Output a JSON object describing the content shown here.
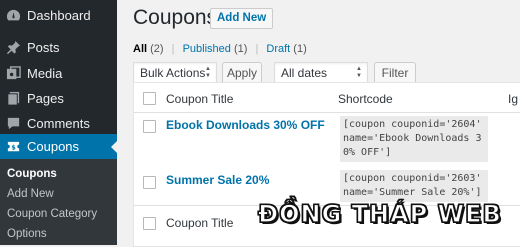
{
  "sidebar": {
    "items": [
      {
        "label": "Dashboard",
        "icon": "dashboard-icon"
      },
      {
        "label": "Posts",
        "icon": "pin-icon"
      },
      {
        "label": "Media",
        "icon": "media-icon"
      },
      {
        "label": "Pages",
        "icon": "pages-icon"
      },
      {
        "label": "Comments",
        "icon": "comments-icon"
      },
      {
        "label": "Coupons",
        "icon": "coupon-icon",
        "current": true
      }
    ],
    "submenu": [
      "Coupons",
      "Add New",
      "Coupon Category",
      "Options"
    ],
    "colors": {
      "bg": "#23282d",
      "current": "#0073aa",
      "submenu_bg": "#32373c"
    }
  },
  "header": {
    "title": "Coupons",
    "add_new": "Add New"
  },
  "filters": {
    "all_label": "All",
    "all_count": "(2)",
    "published_label": "Published",
    "published_count": "(1)",
    "draft_label": "Draft",
    "draft_count": "(1)",
    "separator": "|"
  },
  "toolbar": {
    "bulk_actions": "Bulk Actions",
    "apply": "Apply",
    "dates": "All dates",
    "filter": "Filter"
  },
  "table": {
    "columns": [
      "Coupon Title",
      "Shortcode",
      "Ig"
    ],
    "rows": [
      {
        "title": "Ebook Downloads 30% OFF",
        "shortcode": "[coupon couponid='2604' name='Ebook Downloads 30% OFF']"
      },
      {
        "title": "Summer Sale 20%",
        "shortcode": "[coupon couponid='2603' name='Summer Sale 20%']"
      }
    ]
  },
  "watermark": "ĐỒNG THÁP WEB"
}
